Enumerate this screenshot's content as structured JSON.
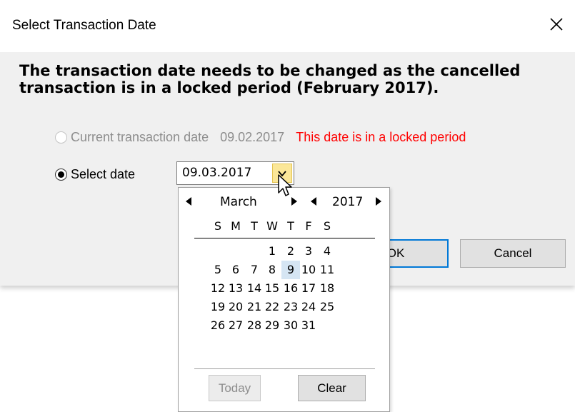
{
  "dialog": {
    "title": "Select Transaction Date",
    "message": "The transaction date needs to be changed as the cancelled transaction is in a locked period (February 2017).",
    "options": {
      "current": {
        "label": "Current transaction date",
        "value": "09.02.2017",
        "warning": "This date is in a locked period",
        "selected": false,
        "enabled": false
      },
      "select": {
        "label": "Select date",
        "value": "09.03.2017",
        "selected": true
      }
    },
    "buttons": {
      "ok": "OK",
      "cancel": "Cancel"
    }
  },
  "calendar": {
    "month": "March",
    "year": "2017",
    "weekdays": [
      "S",
      "M",
      "T",
      "W",
      "T",
      "F",
      "S"
    ],
    "first_weekday_index": 3,
    "days_in_month": 31,
    "selected_day": 9,
    "buttons": {
      "today": "Today",
      "clear": "Clear"
    }
  },
  "colors": {
    "warning": "#ff0000",
    "accent": "#0078d7",
    "dropdown_button": "#fbe798",
    "selected_day_bg": "#d5e5f3"
  },
  "icons": [
    "close-icon",
    "dropdown-arrow-icon",
    "arrow-left-icon",
    "arrow-right-icon",
    "mouse-cursor-icon"
  ]
}
